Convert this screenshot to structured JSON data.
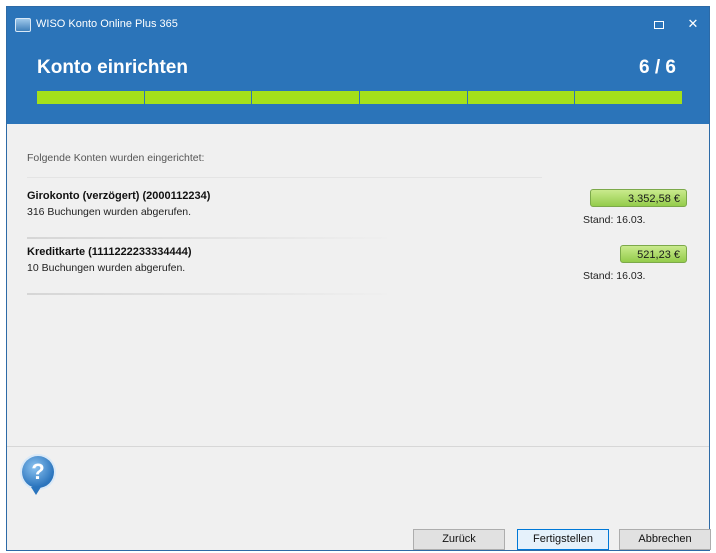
{
  "window": {
    "title": "WISO Konto Online Plus 365",
    "header_title": "Konto einrichten",
    "step_counter": "6 / 6",
    "progress": {
      "completed_steps": 6,
      "total_steps": 6
    },
    "accent_color": "#2b74b9",
    "progress_color": "#a4e01a"
  },
  "content": {
    "intro": "Folgende Konten wurden eingerichtet:",
    "accounts": [
      {
        "name": "Girokonto (verzögert) (2000112234)",
        "detail": "316 Buchungen wurden abgerufen.",
        "balance": "3.352,58 €",
        "stand": "Stand:  16.03."
      },
      {
        "name": "Kreditkarte (1111222233334444)",
        "detail": "10 Buchungen wurden abgerufen.",
        "balance": "521,23 €",
        "stand": "Stand:  16.03."
      }
    ]
  },
  "icons": {
    "help": "help-icon",
    "app": "app-icon"
  },
  "buttons": {
    "help_glyph": "?",
    "back": "Zurück",
    "finish": "Fertigstellen",
    "cancel": "Abbrechen"
  }
}
